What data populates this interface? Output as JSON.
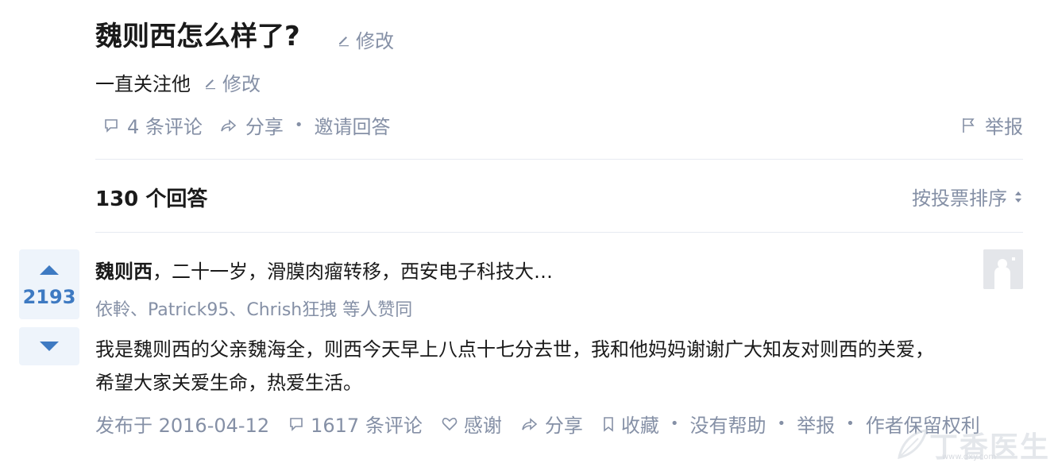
{
  "question": {
    "title": "魏则西怎么样了?",
    "edit_label": "修改",
    "detail": "一直关注他",
    "detail_edit_label": "修改",
    "comments": "4 条评论",
    "share": "分享",
    "invite": "邀请回答",
    "report": "举报"
  },
  "answers_header": {
    "count": "130 个回答",
    "sort": "按投票排序"
  },
  "answer": {
    "votes": "2193",
    "author_line_bold": "魏则西",
    "author_line_rest": "，二十一岁，滑膜肉瘤转移，西安电子科技大…",
    "voters": "依軨、Patrick95、Chrish狂拽 等人赞同",
    "body_line1": "我是魏则西的父亲魏海全，则西今天早上八点十七分去世，我和他妈妈谢谢广大知友对则西的关爱，",
    "body_line2": "希望大家关爱生命，热爱生活。",
    "published": "发布于 2016-04-12",
    "comments": "1617 条评论",
    "thanks": "感谢",
    "share": "分享",
    "collect": "收藏",
    "not_helpful": "没有帮助",
    "report": "举报",
    "copyright": "作者保留权利"
  },
  "watermark": {
    "text": "丁香医生",
    "url": "www.dxy.com"
  },
  "colors": {
    "accent": "#3e7ac2",
    "vote_bg": "#eef4fb",
    "meta_text": "#8590a6",
    "divider": "#e7eaf1"
  },
  "icons": [
    "pencil-icon",
    "comment-icon",
    "share-icon",
    "flag-icon",
    "sort-icon",
    "upvote-icon",
    "downvote-icon",
    "heart-icon",
    "bookmark-icon"
  ]
}
